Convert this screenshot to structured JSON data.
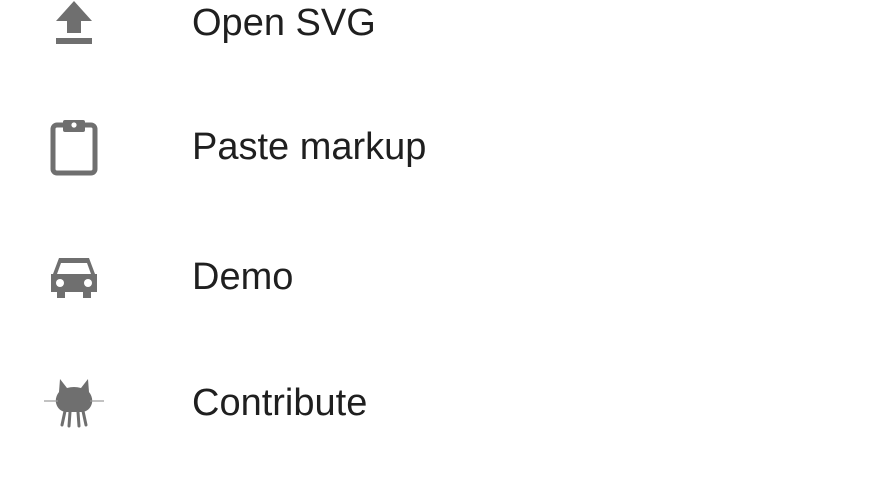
{
  "menu": {
    "items": [
      {
        "label": "Open SVG",
        "icon": "upload-icon"
      },
      {
        "label": "Paste markup",
        "icon": "clipboard-icon"
      },
      {
        "label": "Demo",
        "icon": "car-icon"
      },
      {
        "label": "Contribute",
        "icon": "github-octocat-icon"
      }
    ]
  },
  "colors": {
    "icon": "#6f6f6f",
    "text": "#1f1f1f",
    "background": "#ffffff"
  }
}
